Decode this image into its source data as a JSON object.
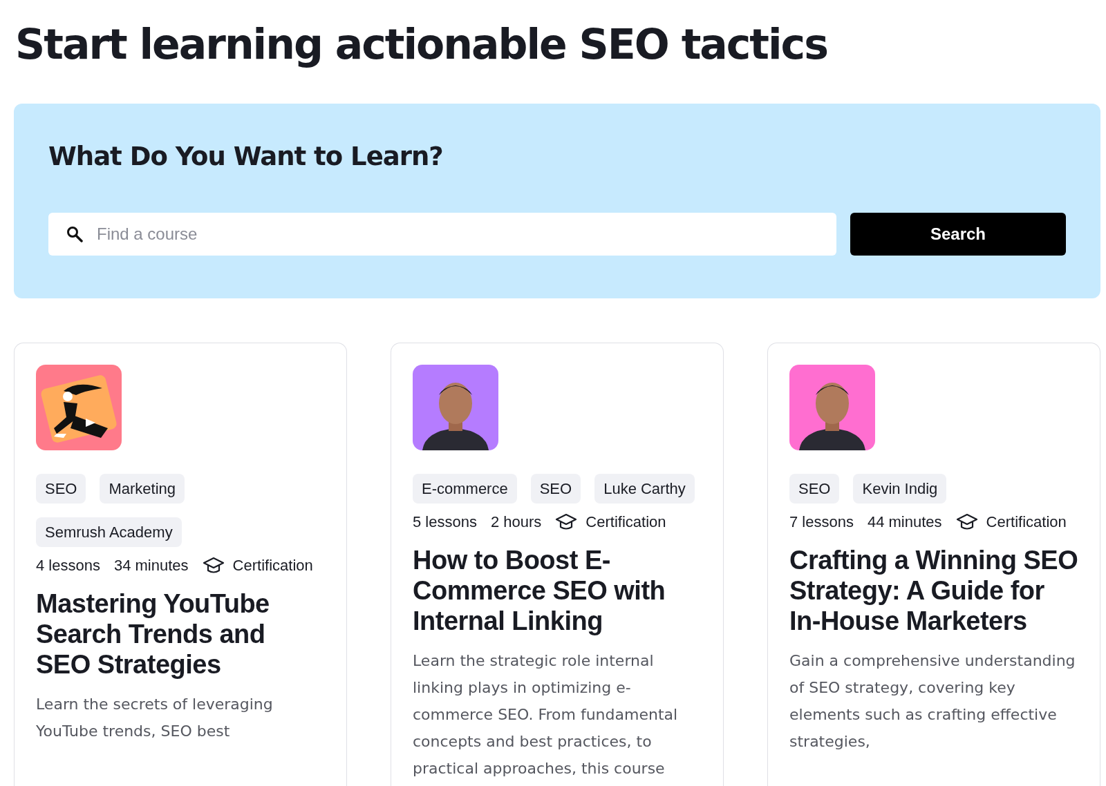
{
  "page_title": "Start learning actionable SEO tactics",
  "search_panel": {
    "heading": "What Do You Want to Learn?",
    "search": {
      "placeholder": "Find a course"
    },
    "button": "Search"
  },
  "courses": [
    {
      "thumbnail": {
        "kind": "illustration",
        "color": "#ff7a8a"
      },
      "tags": [
        "SEO",
        "Marketing",
        "Semrush Academy"
      ],
      "meta": [
        "4 lessons",
        "34 minutes"
      ],
      "certification": "Certification",
      "title": "Mastering YouTube Search Trends and SEO Strategies",
      "description": "Learn the secrets of leveraging YouTube trends, SEO best"
    },
    {
      "thumbnail": {
        "kind": "picture",
        "color": "#b57cff"
      },
      "tags": [
        "E-commerce",
        "SEO",
        "Luke Carthy"
      ],
      "meta": [
        "5 lessons",
        "2 hours"
      ],
      "certification": "Certification",
      "title": "How to Boost E-Commerce SEO with Internal Linking",
      "description": "Learn the strategic role internal linking plays in optimizing e-commerce SEO. From fundamental concepts and best practices, to practical approaches, this course"
    },
    {
      "thumbnail": {
        "kind": "picture",
        "color": "#ff6ed0"
      },
      "tags": [
        "SEO",
        "Kevin Indig"
      ],
      "meta": [
        "7 lessons",
        "44 minutes"
      ],
      "certification": "Certification",
      "title": "Crafting a Winning SEO Strategy: A Guide for In-House Marketers",
      "description": "Gain a comprehensive understanding of SEO strategy, covering key elements such as crafting effective strategies,"
    }
  ]
}
